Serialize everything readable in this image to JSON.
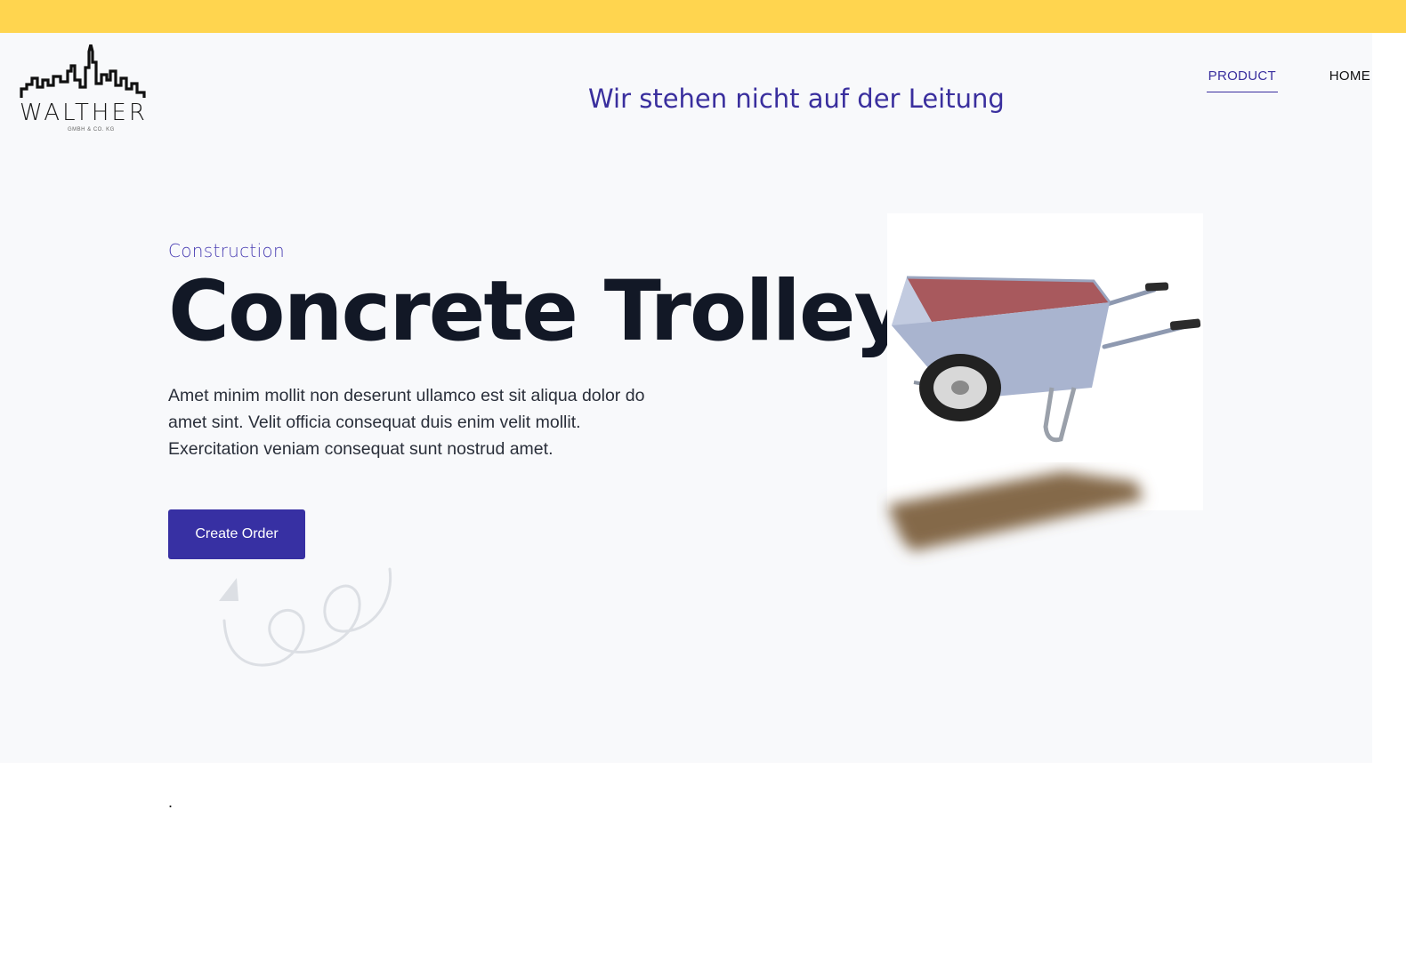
{
  "brand": {
    "name": "WALTHER",
    "subline": "GMBH & CO. KG"
  },
  "header": {
    "slogan": "Wir stehen nicht auf der Leitung"
  },
  "nav": {
    "items": [
      {
        "label": "PRODUCT",
        "active": true
      },
      {
        "label": "HOME",
        "active": false
      }
    ]
  },
  "hero": {
    "category": "Construction",
    "title": "Concrete Trolley",
    "description": "Amet minim mollit non deserunt ullamco est sit aliqua dolor do amet sint. Velit officia consequat duis enim velit mollit. Exercitation veniam consequat sunt nostrud amet.",
    "cta_label": "Create Order"
  },
  "footer": {
    "dot": "."
  },
  "colors": {
    "top_stripe": "#ffd54f",
    "accent": "#3730a3",
    "slogan": "#3a2f9e",
    "panel": "#f8f9fb"
  },
  "icons": {
    "logo": "city-skyline-icon",
    "doodle": "loop-arrow-icon",
    "product": "wheelbarrow-image"
  }
}
